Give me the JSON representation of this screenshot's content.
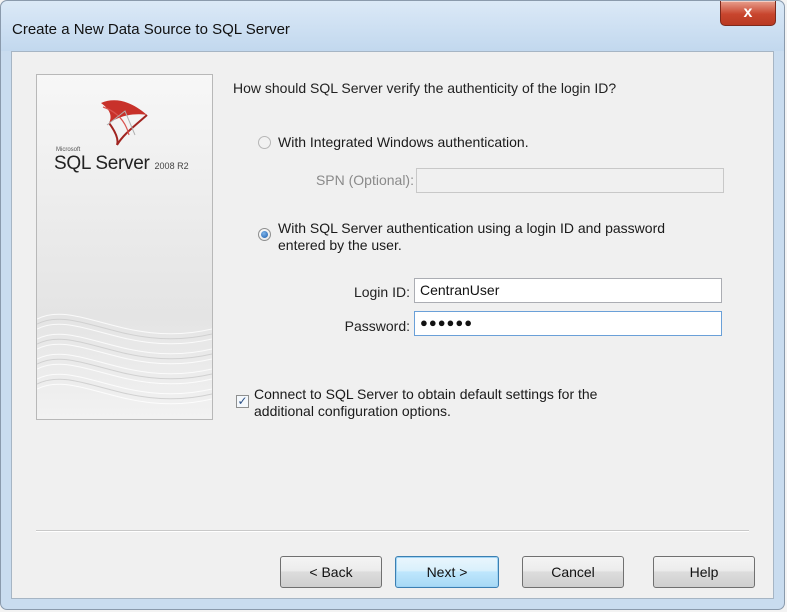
{
  "window": {
    "title": "Create a New Data Source to SQL Server",
    "close_label": "x"
  },
  "banner": {
    "logo_microsoft": "Microsoft",
    "logo_product": "SQL Server",
    "logo_version": "2008 R2"
  },
  "form": {
    "question": "How should SQL Server verify the authenticity of the login ID?",
    "integrated_auth_label": "With Integrated Windows authentication.",
    "integrated_auth_selected": false,
    "spn_label": "SPN (Optional):",
    "spn_value": "",
    "sql_auth_label_line1": "With SQL Server authentication using a login ID and password",
    "sql_auth_label_line2": "entered by the user.",
    "sql_auth_selected": true,
    "login_label": "Login ID:",
    "login_value": "CentranUser",
    "password_label": "Password:",
    "password_value": "●●●●●●",
    "connect_label_line1": "Connect to SQL Server to obtain default settings for the",
    "connect_label_line2": "additional configuration options.",
    "connect_checked": true
  },
  "buttons": {
    "back": "< Back",
    "next": "Next >",
    "cancel": "Cancel",
    "help": "Help"
  },
  "colors": {
    "close_button": "#c8452e",
    "logo_red": "#c8312a"
  }
}
